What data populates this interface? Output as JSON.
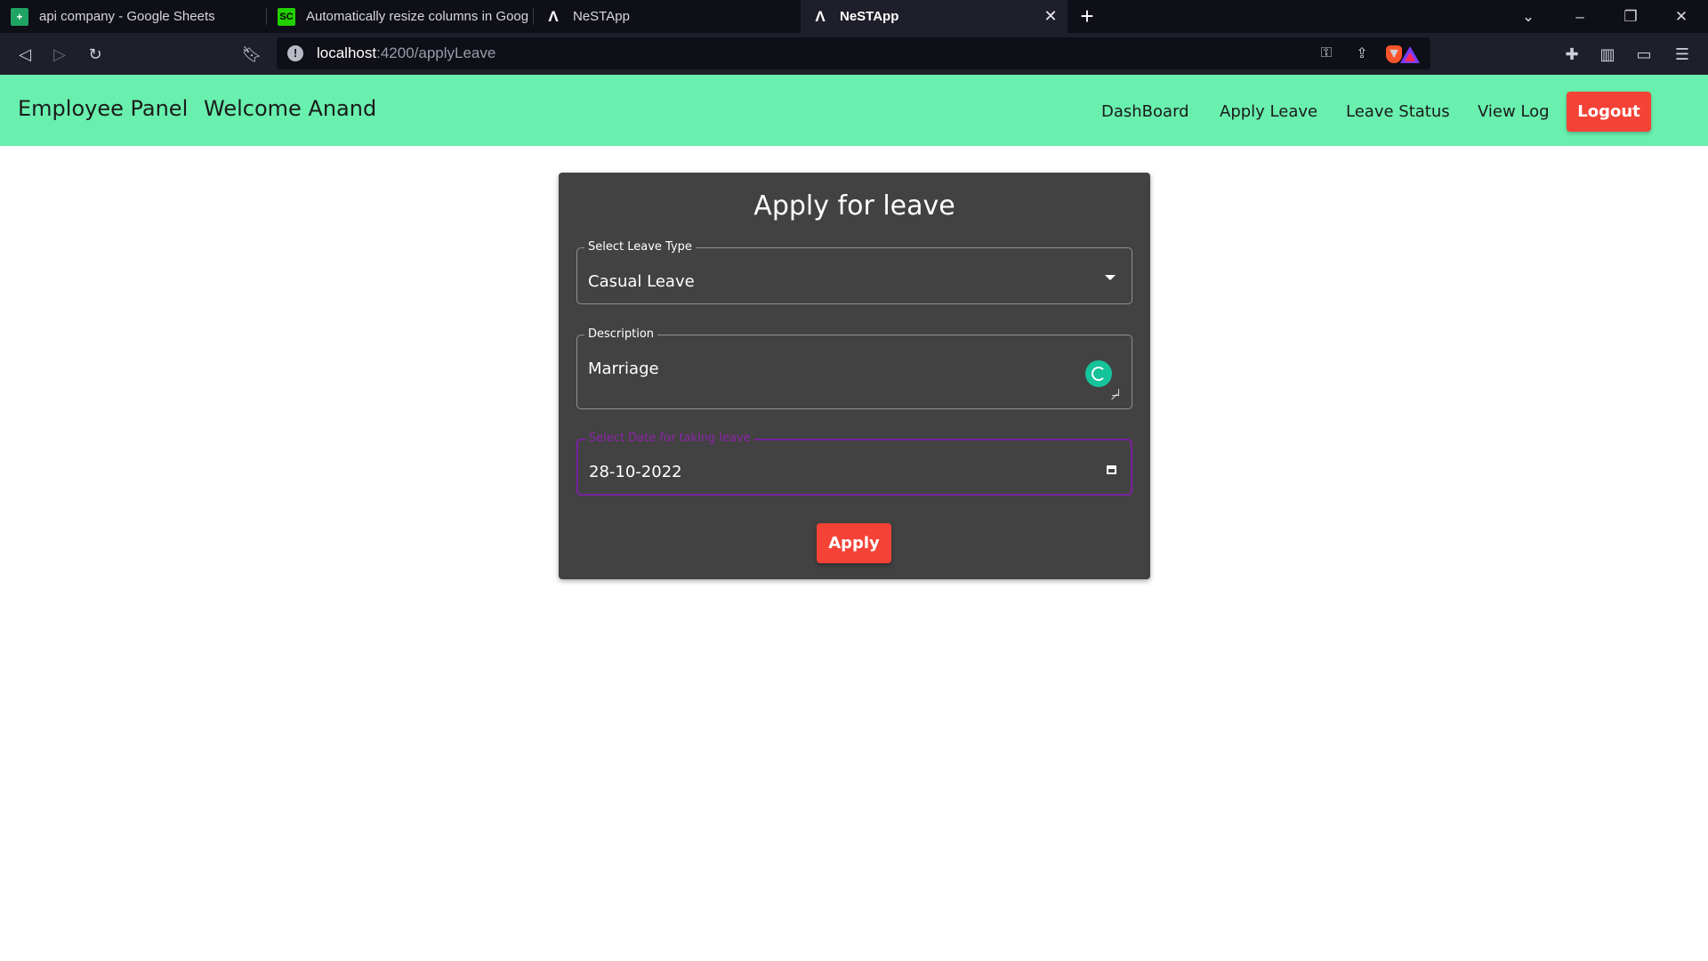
{
  "browser": {
    "tabs": [
      {
        "title": "api company - Google Sheets",
        "icon": "google-sheets-icon"
      },
      {
        "title": "Automatically resize columns in Google",
        "icon": "sc-icon"
      },
      {
        "title": "NeSTApp",
        "icon": "angular-icon"
      },
      {
        "title": "NeSTApp",
        "icon": "angular-icon",
        "active": true
      }
    ],
    "url_host": "localhost",
    "url_path": ":4200/applyLeave",
    "favicon_sc_text": "SC"
  },
  "header": {
    "brand": "Employee Panel",
    "welcome": "Welcome Anand",
    "nav": [
      "DashBoard",
      "Apply Leave",
      "Leave Status",
      "View Log"
    ],
    "logout": "Logout",
    "color": "#69f0ae"
  },
  "form": {
    "title": "Apply for leave",
    "leave_type_label": "Select Leave Type",
    "leave_type_value": "Casual Leave",
    "description_label": "Description",
    "description_value": "Marriage",
    "date_label": "Select Date for taking leave",
    "date_value": "28-10-2022",
    "submit_label": "Apply"
  }
}
